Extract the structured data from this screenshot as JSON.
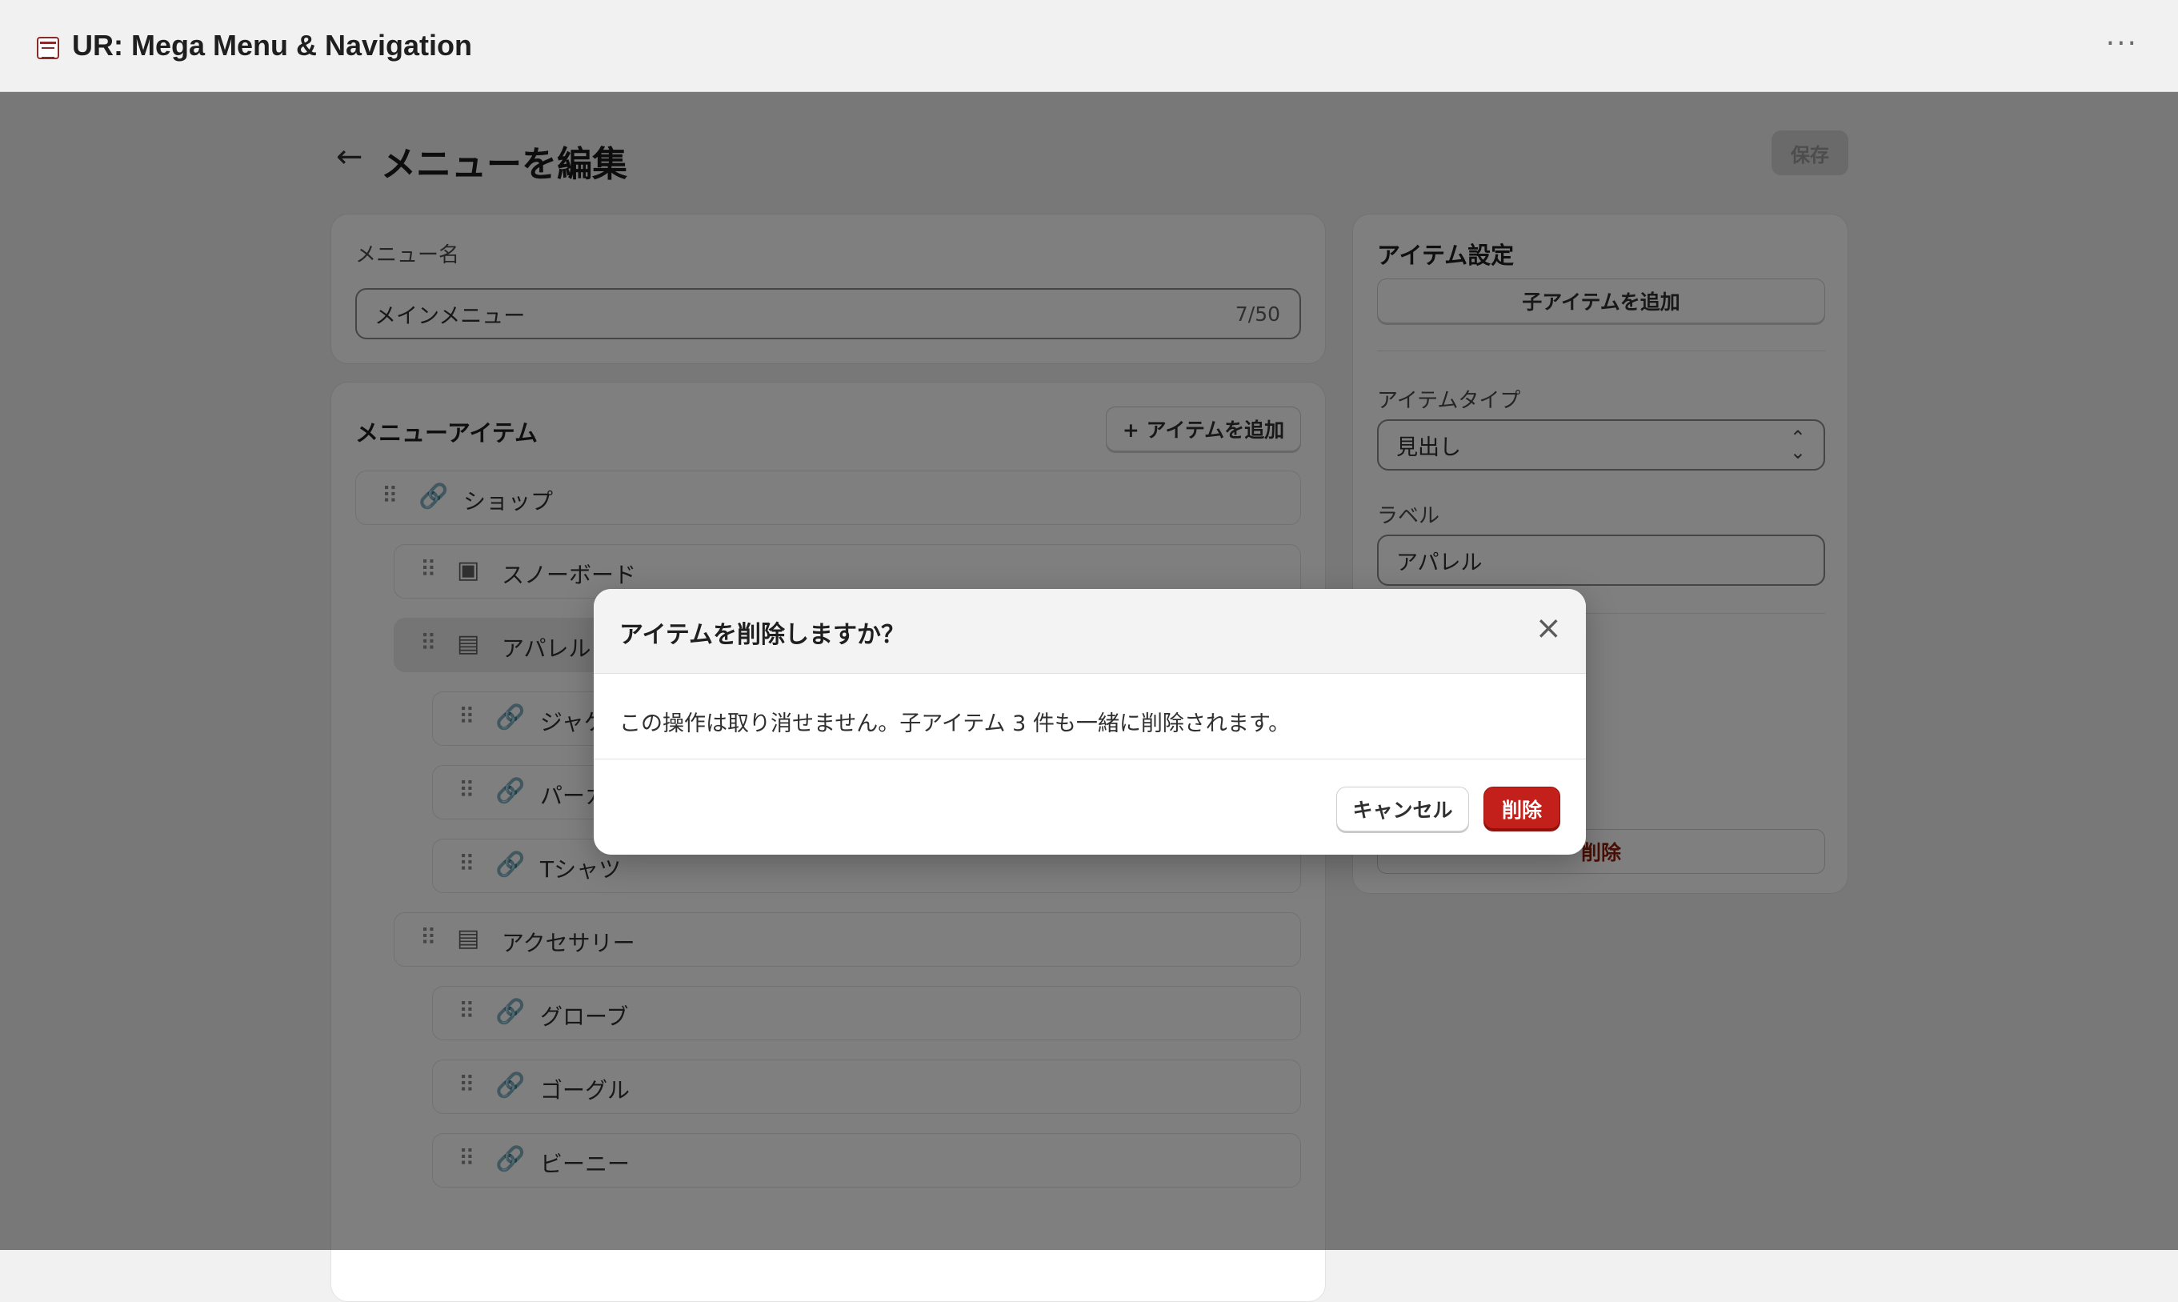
{
  "window": {
    "title": "UR: Mega Menu & Navigation",
    "more_icon": "more-horizontal-icon"
  },
  "page": {
    "title": "メニューを編集",
    "save_label": "保存"
  },
  "menu_name": {
    "label": "メニュー名",
    "value": "メインメニュー",
    "counter": "7/50"
  },
  "menu_items": {
    "title": "メニューアイテム",
    "add_label": "+ アイテムを追加",
    "items": [
      {
        "label": "ショップ",
        "icon": "link-icon"
      },
      {
        "label": "スノーボード",
        "icon": "image-icon"
      },
      {
        "label": "アパレル",
        "icon": "heading-icon"
      },
      {
        "label": "ジャケ",
        "icon": "link-icon"
      },
      {
        "label": "パーカ",
        "icon": "link-icon"
      },
      {
        "label": "Tシャツ",
        "icon": "link-icon"
      },
      {
        "label": "アクセサリー",
        "icon": "heading-icon"
      },
      {
        "label": "グローブ",
        "icon": "link-icon"
      },
      {
        "label": "ゴーグル",
        "icon": "link-icon"
      },
      {
        "label": "ビーニー",
        "icon": "link-icon"
      }
    ]
  },
  "item_settings": {
    "title": "アイテム設定",
    "add_child_label": "子アイテムを追加",
    "type_label": "アイテムタイプ",
    "type_value": "見出し",
    "label_label": "ラベル",
    "label_value": "アパレル",
    "delete_partial": "削除"
  },
  "dialog": {
    "title": "アイテムを削除しますか？",
    "message": "この操作は取り消せません。子アイテム 3 件も一緒に削除されます。",
    "cancel_label": "キャンセル",
    "delete_label": "削除"
  },
  "colors": {
    "danger": "#c4201b",
    "overlay": "rgba(0,0,0,0.5)"
  }
}
